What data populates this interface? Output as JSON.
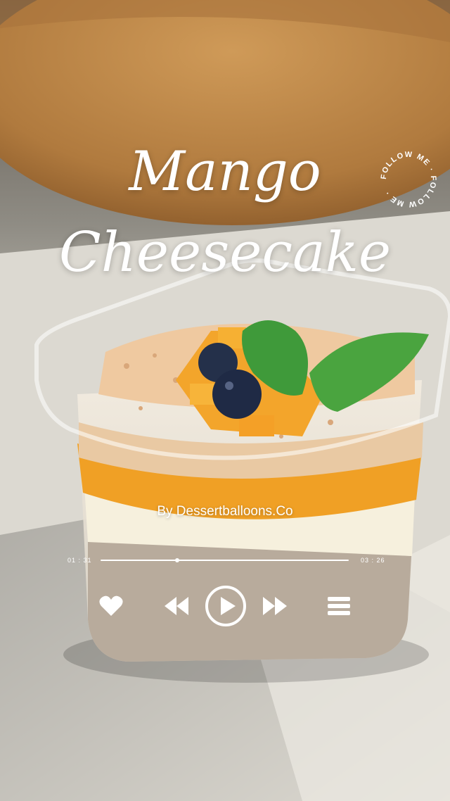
{
  "title": {
    "line1": "Mango",
    "line2": "Cheesecake"
  },
  "badge": {
    "text": "FOLLOW ME · FOLLOW ME · "
  },
  "byline": "By Dessertballoons.Co",
  "player": {
    "current_time": "01 : 31",
    "total_time": "03 : 26",
    "progress": 0.31,
    "icons": {
      "like": "heart-icon",
      "rewind": "rewind-icon",
      "play": "play-icon",
      "forward": "fast-forward-icon",
      "menu": "menu-icon"
    }
  },
  "colors": {
    "background_table": "#d8d6cf",
    "wood": "#b98448",
    "mango": "#f0a025",
    "cream": "#f4eedb",
    "ui": "#ffffff"
  }
}
